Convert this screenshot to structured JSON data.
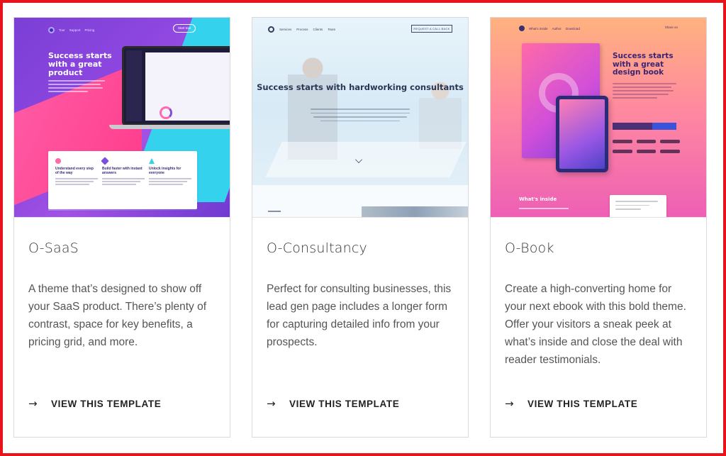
{
  "cards": [
    {
      "title": "O-SaaS",
      "description": "A theme that’s designed to show off your SaaS product. There’s plenty of contrast, space for key benefits, a pricing grid, and more.",
      "cta": "VIEW THIS TEMPLATE",
      "preview": {
        "headline": "Success starts with a great product",
        "nav": [
          "Tour",
          "Support",
          "Pricing"
        ],
        "button": "Start trial",
        "features": [
          "Understand every step of the way",
          "Build faster with instant answers",
          "Unlock insights for everyone"
        ],
        "colors": {
          "primary": "#8e47e0",
          "accent": "#35d2ee",
          "pink": "#ff4f9a"
        }
      }
    },
    {
      "title": "O-Consultancy",
      "description": "Perfect for consulting businesses, this lead gen page includes a longer form for capturing detailed info from your prospects.",
      "cta": "VIEW THIS TEMPLATE",
      "preview": {
        "headline": "Success starts with hardworking consultants",
        "nav": [
          "Services",
          "Process",
          "Clients",
          "Team"
        ],
        "button": "REQUEST A CALL BACK",
        "colors": {
          "primary": "#2a3656",
          "background": "#e1eff8"
        }
      }
    },
    {
      "title": "O-Book",
      "description": "Create a high-converting home for your next ebook with this bold theme. Offer your visitors a sneak peek at what’s inside and close the deal with reader testimonials.",
      "cta": "VIEW THIS TEMPLATE",
      "preview": {
        "headline": "Success starts with a great design book",
        "nav": [
          "What's inside",
          "Author",
          "Download"
        ],
        "social": "Share on",
        "section_title": "What's inside",
        "colors": {
          "top": "#ffb27f",
          "bottom": "#ee5fb5",
          "ink": "#3a2670"
        }
      }
    }
  ],
  "frame_color": "#e8141b",
  "arrow_icon": "arrow-right-icon"
}
